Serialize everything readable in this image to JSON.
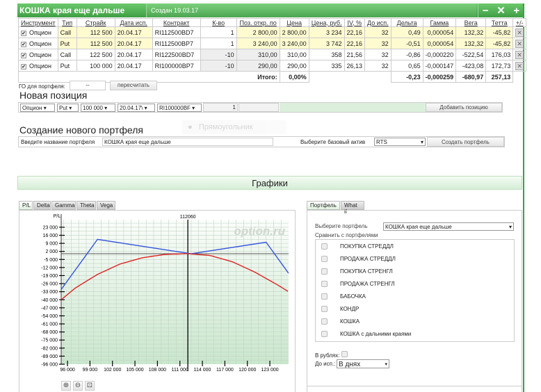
{
  "portfolio": {
    "title": "КОШКА края еще дальше",
    "created": "Создан 19.03.17",
    "window_icons": [
      "minus-icon",
      "close-icon",
      "plus-icon"
    ]
  },
  "table": {
    "headers": [
      "Инструмент",
      "Тип",
      "Страйк",
      "Дата исп.",
      "Контракт",
      "К-во",
      "Поз. откр. по",
      "Цена",
      "Цена, руб.",
      "IV, %",
      "До исп.",
      "Дельта",
      "Гамма",
      "Вега",
      "Тетта",
      "+/-"
    ],
    "rows": [
      {
        "checked": true,
        "instrument": "Опцион",
        "type": "Call",
        "strike": "112 500",
        "date": "20.04.17",
        "contract": "RI112500BD7",
        "qty": "1",
        "open": "2 800,00",
        "price": "2 800,00",
        "price_rub": "3 234",
        "iv": "22,16",
        "days": "32",
        "delta": "0,49",
        "gamma": "0,000054",
        "vega": "132,32",
        "theta": "-45,82",
        "highlight": true
      },
      {
        "checked": true,
        "instrument": "Опцион",
        "type": "Put",
        "strike": "112 500",
        "date": "20.04.17",
        "contract": "RI112500BP7",
        "qty": "1",
        "open": "3 240,00",
        "price": "3 240,00",
        "price_rub": "3 742",
        "iv": "22,16",
        "days": "32",
        "delta": "-0,51",
        "gamma": "0,000054",
        "vega": "132,32",
        "theta": "-45,82",
        "highlight": true
      },
      {
        "checked": true,
        "instrument": "Опцион",
        "type": "Call",
        "strike": "122 500",
        "date": "20.04.17",
        "contract": "RI122500BD7",
        "qty": "-10",
        "open": "310,00",
        "price": "310,00",
        "price_rub": "358",
        "iv": "21,56",
        "days": "32",
        "delta": "-0,86",
        "gamma": "-0,000220",
        "vega": "-522,54",
        "theta": "176,03",
        "highlight": false
      },
      {
        "checked": true,
        "instrument": "Опцион",
        "type": "Put",
        "strike": "100 000",
        "date": "20.04.17",
        "contract": "RI100000BP7",
        "qty": "-10",
        "open": "290,00",
        "price": "290,00",
        "price_rub": "335",
        "iv": "26,13",
        "days": "32",
        "delta": "0,65",
        "gamma": "-0,000147",
        "vega": "-423,08",
        "theta": "172,73",
        "highlight": false
      }
    ],
    "total": {
      "label": "Итого:",
      "price": "0,00%",
      "delta": "-0,23",
      "gamma": "-0,000259",
      "vega": "-680,97",
      "theta": "257,13"
    }
  },
  "go": {
    "label": "ГО для портфеля:",
    "value": "--",
    "recalc": "пересчитать"
  },
  "new_position": {
    "title": "Новая позиция",
    "instrument": "Опцион",
    "type": "Put",
    "strike": "100 000",
    "date": "20.04.17\\",
    "contract": "RI100000BF",
    "qty": "1",
    "add": "Добавить позицию"
  },
  "ghost": "Прямоугольник",
  "new_portfolio": {
    "title": "Создание нового портфеля",
    "name_label": "Введите название портфеля",
    "name_value": "КОШКА края еще дальше",
    "asset_label": "Выберите базовый актив",
    "asset": "RTS",
    "create": "Создать портфель"
  },
  "graphs": {
    "title": "Графики",
    "tabs": [
      "P/L",
      "Delta",
      "Gamma",
      "Theta",
      "Vega"
    ],
    "active_tab": "P/L",
    "zoom_icons": [
      "zoom-in-icon",
      "zoom-out-icon",
      "zoom-reset-icon"
    ]
  },
  "chart_data": {
    "type": "line",
    "ylabel": "P/L",
    "watermark": "option.ru",
    "marker_label": "112060",
    "marker_x": 112060,
    "xlim": [
      95160,
      125500
    ],
    "ylim": [
      -96000,
      29600
    ],
    "xticks": [
      "96 000",
      "99 000",
      "102 000",
      "105 000",
      "108 000",
      "111 000",
      "114 000",
      "117 000",
      "120 000",
      "123 000"
    ],
    "yticks": [
      "23 000",
      "16 000",
      "9 000",
      "2 000",
      "-5 000",
      "-12 000",
      "-19 000",
      "-26 000",
      "-33 000",
      "-40 000",
      "-47 000",
      "-54 000",
      "-61 000",
      "-68 000",
      "-75 000",
      "-82 000",
      "-89 000",
      "-96 000"
    ],
    "grid": true,
    "series": [
      {
        "color": "#3355dd",
        "x": [
          95160,
          100000,
          112500,
          122500,
          125500
        ],
        "y": [
          -31100,
          12460,
          -40,
          9960,
          -17040
        ]
      },
      {
        "color": "#dd2222",
        "x": [
          95160,
          97000,
          100000,
          103000,
          106000,
          109000,
          112060,
          115000,
          118000,
          121000,
          124000,
          125500
        ],
        "y": [
          -40000,
          -30000,
          -18000,
          -9000,
          -3500,
          -600,
          0,
          -1500,
          -7000,
          -16000,
          -27000,
          -33000
        ]
      }
    ]
  },
  "side": {
    "tabs": [
      "Портфель",
      "What if"
    ],
    "active_tab": "Портфель",
    "select_label": "Выберите портфель",
    "select_value": "КОШКА края еще дальше",
    "compare_label": "Сравнить с портфелями",
    "compare": [
      "ПОКУПКА СТРЕДДЛ",
      "ПРОДАЖА СТРЕДДЛ",
      "ПОКУПКА СТРЕНГЛ",
      "ПРОДАЖА СТРЕНГЛ",
      "БАБОЧКА",
      "КОНДР",
      "КОШКА",
      "КОШКА с дальними краями"
    ],
    "rub_label": "В рублях:",
    "rub_checked": false,
    "exp_label": "До исп.:",
    "exp_value": "В днях"
  }
}
